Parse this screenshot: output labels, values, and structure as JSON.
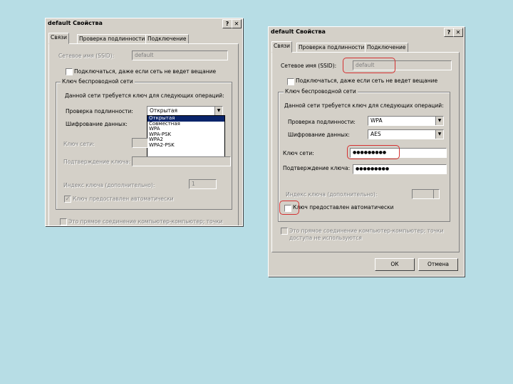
{
  "left_dialog": {
    "title": "default Свойства",
    "help_btn": "?",
    "close_btn": "✕",
    "tabs": [
      "Связи",
      "Проверка подлинности",
      "Подключение"
    ],
    "ssid_label": "Сетевое имя (SSID):",
    "ssid_value": "default",
    "broadcast_label": "Подключаться, даже если сеть не ведет вещание",
    "group_title": "Ключ беспроводной сети",
    "group_desc": "Данной сети требуется ключ для следующих операций:",
    "auth_label": "Проверка подлинности:",
    "auth_value": "Открытая",
    "auth_options": [
      "Открытая",
      "Совместная",
      "WPA",
      "WPA-PSK",
      "WPA2",
      "WPA2-PSK"
    ],
    "enc_label": "Шифрование данных:",
    "key_label": "Ключ сети:",
    "confirm_label": "Подтверждение ключа:",
    "index_label": "Индекс ключа (дополнительно):",
    "index_value": "1",
    "auto_key_label": "Ключ предоставлен автоматически",
    "adhoc_label": "Это прямое соединение компьютер-компьютер; точки"
  },
  "right_dialog": {
    "title": "default Свойства",
    "help_btn": "?",
    "close_btn": "✕",
    "tabs": [
      "Связи",
      "Проверка подлинности",
      "Подключение"
    ],
    "ssid_label": "Сетевое имя (SSID):",
    "ssid_value": "default",
    "broadcast_label": "Подключаться, даже если сеть не ведет вещание",
    "group_title": "Ключ беспроводной сети",
    "group_desc": "Данной сети требуется ключ для следующих операций:",
    "auth_label": "Проверка подлинности:",
    "auth_value": "WPA",
    "enc_label": "Шифрование данных:",
    "enc_value": "AES",
    "key_label": "Ключ сети:",
    "key_value": "●●●●●●●●●",
    "confirm_label": "Подтверждение ключа:",
    "confirm_value": "●●●●●●●●●",
    "index_label": "Индекс ключа (дополнительно):",
    "auto_key_label": "Ключ предоставлен автоматически",
    "adhoc_label_1": "Это прямое соединение компьютер-компьютер; точки",
    "adhoc_label_2": "доступа не используются",
    "ok": "ОК",
    "cancel": "Отмена"
  }
}
